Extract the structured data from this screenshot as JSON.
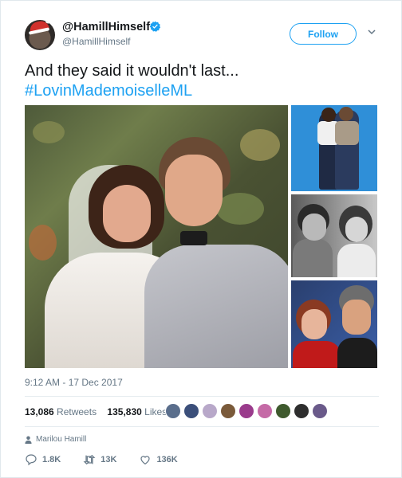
{
  "author": {
    "display_name": "@HamillHimself",
    "handle": "@HamillHimself",
    "verified": true,
    "verified_color": "#1da1f2"
  },
  "follow_button": {
    "label": "Follow"
  },
  "tweet": {
    "text": "And they said it wouldn't last...",
    "hashtag": "#LovinMademoiselleML"
  },
  "media": {
    "count": 4,
    "main": "wedding photo",
    "thumbnails": [
      "couple on blue background",
      "black-and-white couple portrait",
      "couple recent photo"
    ]
  },
  "meta": {
    "timestamp": "9:12 AM - 17 Dec 2017",
    "retweets_count": "13,086",
    "retweets_label": "Retweets",
    "likes_count": "135,830",
    "likes_label": "Likes",
    "liker_avatars": [
      "#5a6e8c",
      "#3b4f7a",
      "#b8a8c9",
      "#7a5a3a",
      "#9a3b8c",
      "#c56aa6",
      "#3f5a2e",
      "#2e2e2e",
      "#6a5a8a"
    ]
  },
  "attribution": {
    "name": "Marilou Hamill",
    "icon": "person-icon"
  },
  "actions": {
    "reply": {
      "icon": "reply-icon",
      "count": "1.8K"
    },
    "retweet": {
      "icon": "retweet-icon",
      "count": "13K"
    },
    "like": {
      "icon": "heart-icon",
      "count": "136K"
    }
  },
  "colors": {
    "accent": "#1da1f2",
    "secondary_text": "#657786",
    "divider": "#e6ecf0"
  }
}
